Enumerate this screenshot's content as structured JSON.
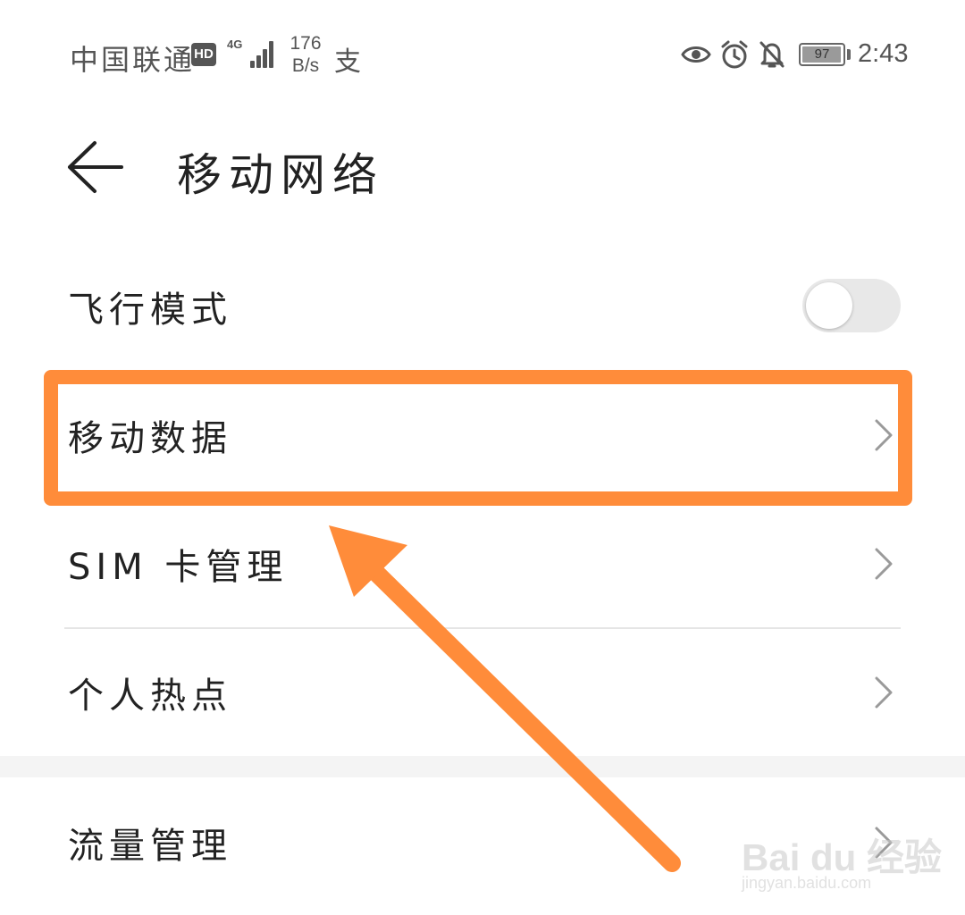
{
  "status_bar": {
    "carrier": "中国联通",
    "hd_badge": "HD",
    "network_type": "4G",
    "speed_value": "176",
    "speed_unit": "B/s",
    "pay_icon": "支",
    "battery_level": "97",
    "battery_fraction": 0.97,
    "time": "2:43",
    "icons": [
      "eye-icon",
      "alarm-icon",
      "bell-off-icon"
    ]
  },
  "header": {
    "back_icon": "arrow-left-icon",
    "title": "移动网络"
  },
  "settings": {
    "airplane_mode": {
      "label": "飞行模式",
      "enabled": false
    },
    "mobile_data": {
      "label": "移动数据"
    },
    "sim_management": {
      "label": "SIM 卡管理"
    },
    "hotspot": {
      "label": "个人热点"
    },
    "data_usage": {
      "label": "流量管理"
    }
  },
  "annotation": {
    "color": "#ff8c3a"
  },
  "watermark": {
    "logo": "Bai du 经验",
    "url": "jingyan.baidu.com"
  }
}
